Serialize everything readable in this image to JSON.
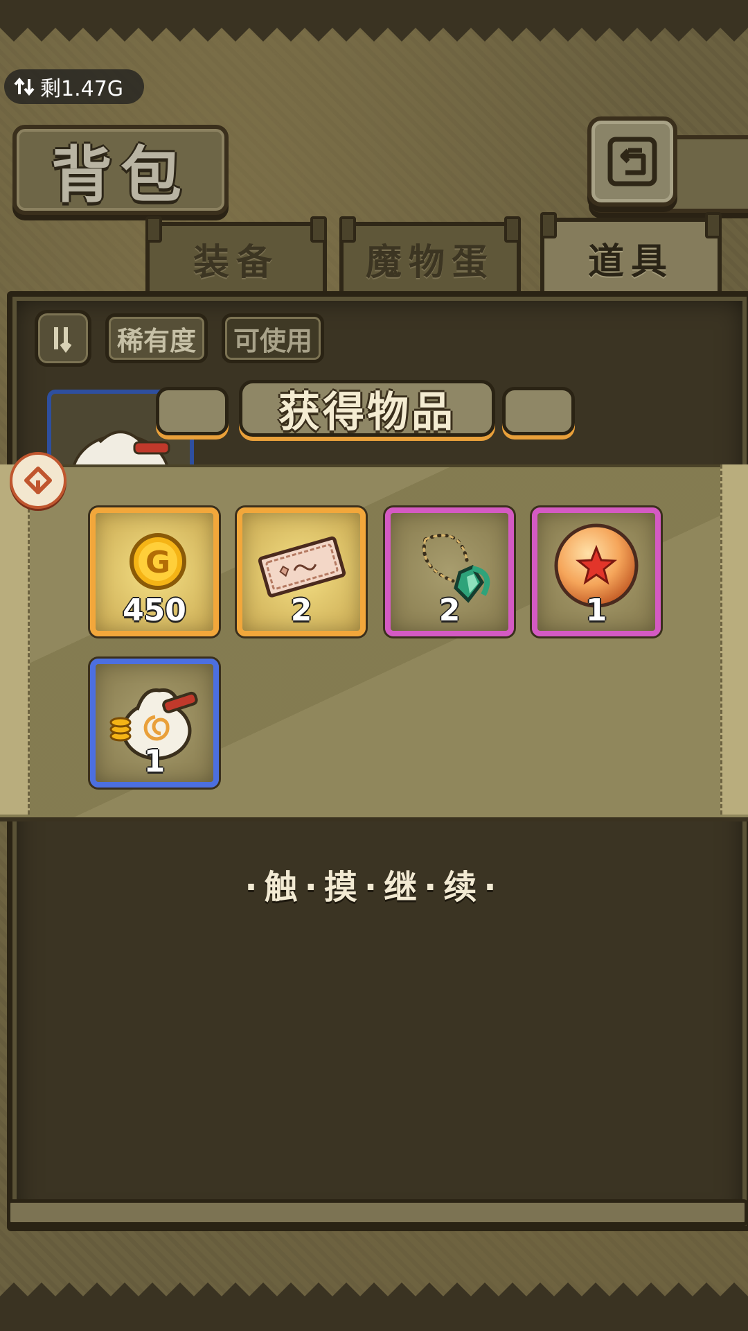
{
  "status": {
    "data_remaining": "剩1.47G",
    "icon": "data-transfer-icon"
  },
  "header": {
    "title": "背包",
    "back_icon": "return-icon"
  },
  "tabs": [
    {
      "label": "装备",
      "active": false
    },
    {
      "label": "魔物蛋",
      "active": false
    },
    {
      "label": "道具",
      "active": true
    }
  ],
  "filters": {
    "sort_icon": "sort-toggle-icon",
    "rarity": "稀有度",
    "usable": "可使用"
  },
  "reward_popup": {
    "title": "获得物品",
    "collapse_icon": "collapse-arrow-icon",
    "items": [
      {
        "name": "gold-coin-icon",
        "count": "450",
        "rarity_color": "#f2a73b"
      },
      {
        "name": "ticket-icon",
        "count": "2",
        "rarity_color": "#f2a73b"
      },
      {
        "name": "gem-amulet-icon",
        "count": "2",
        "rarity_color": "#d45ac3"
      },
      {
        "name": "star-orb-icon",
        "count": "1",
        "rarity_color": "#d45ac3"
      },
      {
        "name": "money-bag-icon",
        "count": "1",
        "rarity_color": "#4c6fe0"
      }
    ],
    "continue_hint": "·触·摸·继·续·"
  },
  "colors": {
    "panel_bg": "#3b3423",
    "band_bg": "#8b8255",
    "accent_orange": "#e9a03a"
  }
}
